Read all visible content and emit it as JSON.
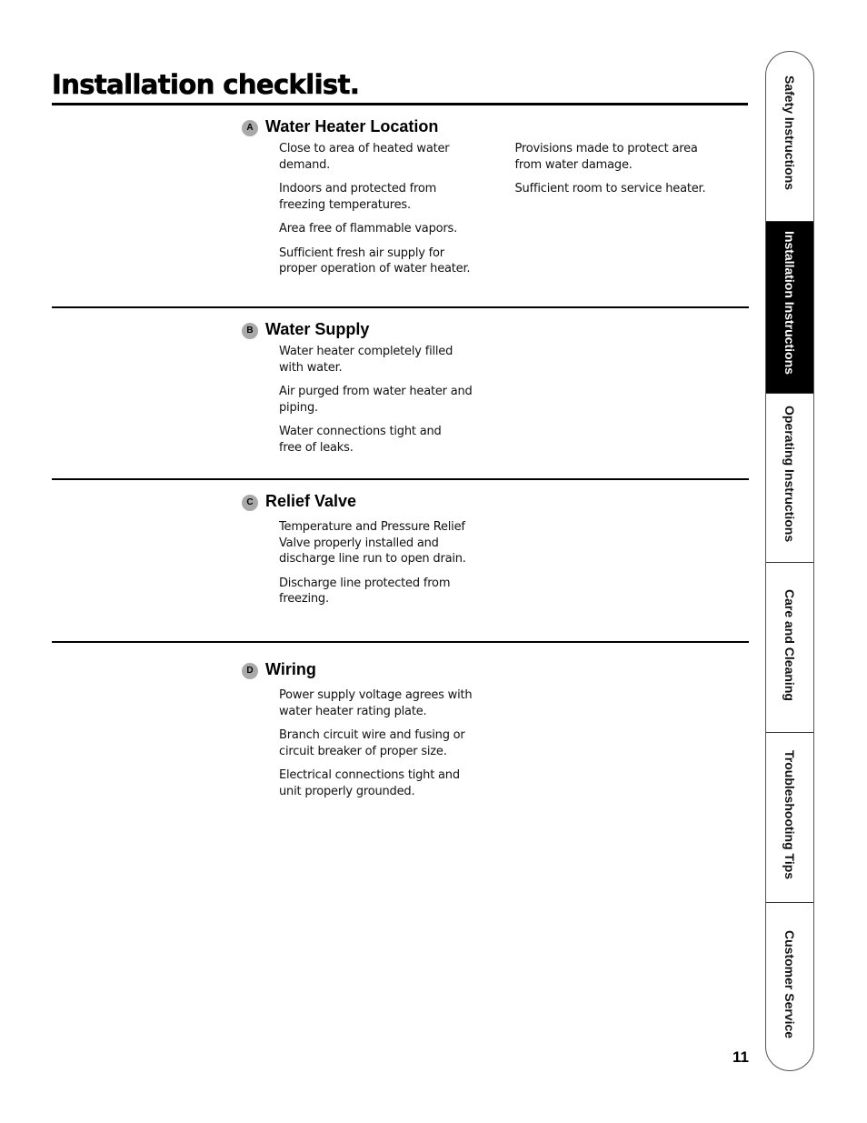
{
  "page": {
    "title": "Installation checklist.",
    "page_number": "11"
  },
  "sections": [
    {
      "letter": "A",
      "title": "Water Heater Location",
      "columns": [
        [
          "Close to area of heated water\ndemand.",
          "Indoors and protected from\nfreezing temperatures.",
          "Area free of flammable vapors.",
          "Sufficient fresh air supply for\nproper operation of water heater."
        ],
        [
          "Provisions made to protect area\nfrom water damage.",
          "Sufficient room to service heater."
        ]
      ]
    },
    {
      "letter": "B",
      "title": "Water Supply",
      "columns": [
        [
          "Water heater completely filled\nwith water.",
          "Air purged from water heater and\npiping.",
          "Water connections tight and\nfree of leaks."
        ]
      ]
    },
    {
      "letter": "C",
      "title": "Relief Valve",
      "columns": [
        [
          "Temperature and Pressure Relief\nValve properly installed and\ndischarge line run to open drain.",
          "Discharge line protected from\nfreezing."
        ]
      ]
    },
    {
      "letter": "D",
      "title": "Wiring",
      "columns": [
        [
          "Power supply voltage agrees with\nwater heater rating plate.",
          "Branch circuit wire and fusing or\ncircuit breaker of proper size.",
          "Electrical connections tight and\nunit properly grounded."
        ]
      ]
    }
  ],
  "side_tabs": [
    {
      "label": "Safety Instructions",
      "active": false
    },
    {
      "label": "Installation Instructions",
      "active": true
    },
    {
      "label": "Operating Instructions",
      "active": false
    },
    {
      "label": "Care and Cleaning",
      "active": false
    },
    {
      "label": "Troubleshooting Tips",
      "active": false
    },
    {
      "label": "Customer Service",
      "active": false
    }
  ]
}
